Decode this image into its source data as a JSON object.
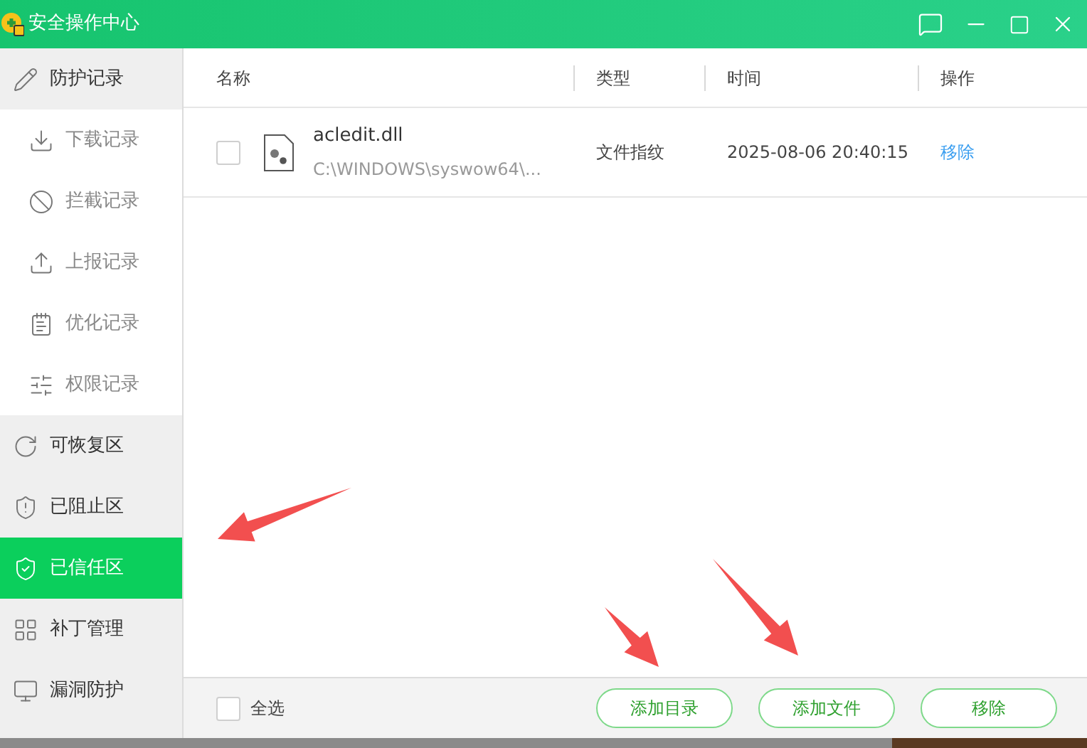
{
  "window": {
    "title": "安全操作中心"
  },
  "sidebar": {
    "items": [
      {
        "label": "防护记录",
        "selected": false,
        "children": [
          {
            "label": "下载记录",
            "selected": false
          },
          {
            "label": "拦截记录",
            "selected": false
          },
          {
            "label": "上报记录",
            "selected": false
          },
          {
            "label": "优化记录",
            "selected": false
          },
          {
            "label": "权限记录",
            "selected": false
          }
        ]
      },
      {
        "label": "可恢复区",
        "selected": false
      },
      {
        "label": "已阻止区",
        "selected": false
      },
      {
        "label": "已信任区",
        "selected": true
      },
      {
        "label": "补丁管理",
        "selected": false
      },
      {
        "label": "漏洞防护",
        "selected": false
      }
    ]
  },
  "table": {
    "columns": [
      "名称",
      "类型",
      "时间",
      "操作"
    ],
    "rows": [
      {
        "checked": false,
        "name": "acledit.dll",
        "path": "C:\\WINDOWS\\syswow64\\...",
        "type": "文件指纹",
        "time": "2025-08-06 20:40:15",
        "action": "移除"
      }
    ]
  },
  "footer": {
    "select_all": {
      "label": "全选",
      "checked": false
    },
    "buttons": [
      "添加目录",
      "添加文件",
      "移除"
    ]
  }
}
